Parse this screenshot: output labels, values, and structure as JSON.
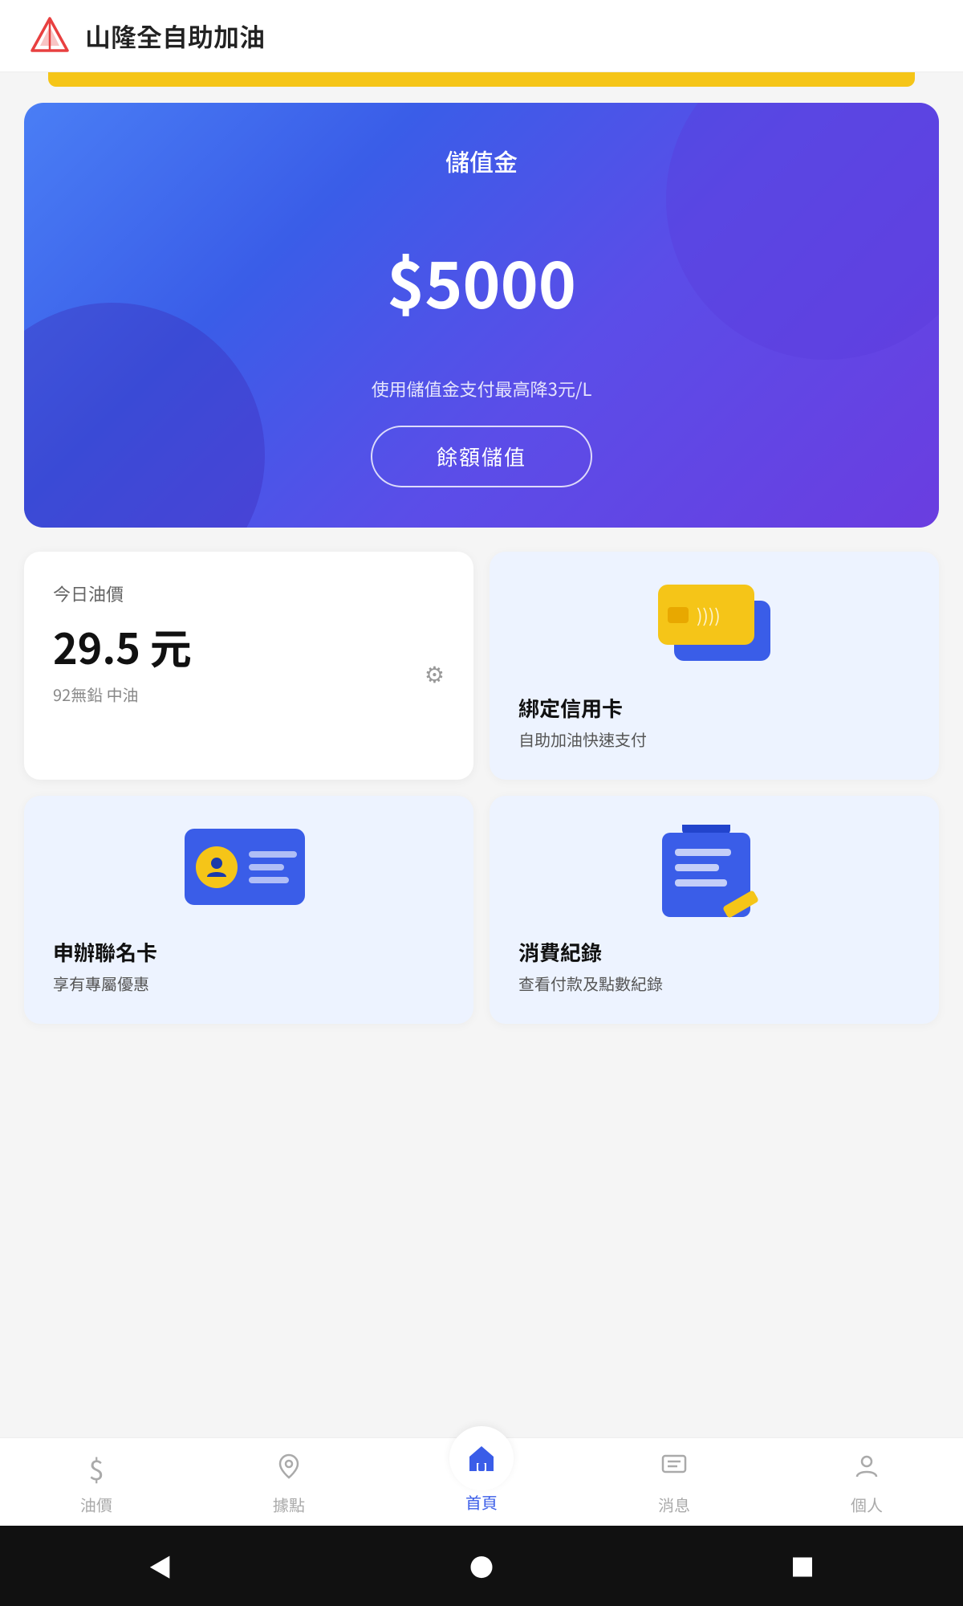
{
  "app": {
    "title": "山隆全自助加油",
    "icon_alt": "triangle-logo"
  },
  "yellow_bar": true,
  "balance_card": {
    "label": "儲值金",
    "amount": "$5000",
    "sub_text": "使用儲值金支付最高降3元/L",
    "button_label": "餘額儲值"
  },
  "oil_price_card": {
    "top_label": "今日油價",
    "price": "29.5 元",
    "sub": "92無鉛 中油"
  },
  "credit_card": {
    "title": "綁定信用卡",
    "sub": "自助加油快速支付"
  },
  "member_card": {
    "title": "申辦聯名卡",
    "sub": "享有專屬優惠"
  },
  "record_card": {
    "title": "消費紀錄",
    "sub": "查看付款及點數紀錄"
  },
  "bottom_nav": {
    "items": [
      {
        "label": "油價",
        "icon": "$",
        "active": false
      },
      {
        "label": "據點",
        "icon": "⊕",
        "active": false
      },
      {
        "label": "首頁",
        "icon": "🏠",
        "active": true
      },
      {
        "label": "消息",
        "icon": "☰",
        "active": false
      },
      {
        "label": "個人",
        "icon": "👤",
        "active": false
      }
    ]
  }
}
